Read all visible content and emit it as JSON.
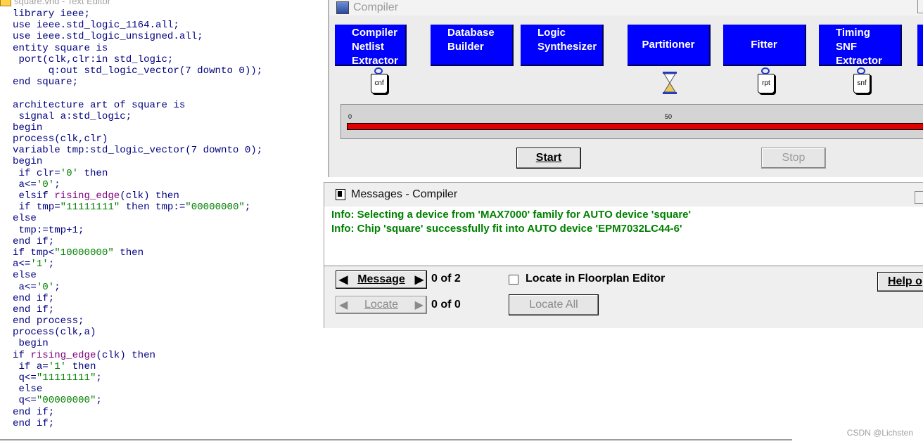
{
  "editor": {
    "title": "square.vhd - Text Editor",
    "lines": [
      [
        {
          "t": "library ieee;"
        }
      ],
      [
        {
          "t": "use ieee.std_logic_1164.all;"
        }
      ],
      [
        {
          "t": "use ieee.std_logic_unsigned.all;"
        }
      ],
      [
        {
          "t": "entity square is"
        }
      ],
      [
        {
          "t": " port(clk,clr:in std_logic;"
        }
      ],
      [
        {
          "t": "      q:out std_logic_vector(7 downto 0));"
        }
      ],
      [
        {
          "t": "end square;"
        }
      ],
      [
        {
          "t": ""
        }
      ],
      [
        {
          "t": "architecture art of square is"
        }
      ],
      [
        {
          "t": " signal a:std_logic;"
        }
      ],
      [
        {
          "t": "begin"
        }
      ],
      [
        {
          "t": "process(clk,clr)"
        }
      ],
      [
        {
          "t": "variable tmp:std_logic_vector(7 downto 0);"
        }
      ],
      [
        {
          "t": "begin"
        }
      ],
      [
        {
          "t": " if clr="
        },
        {
          "t": "'0'",
          "c": "st"
        },
        {
          "t": " then"
        }
      ],
      [
        {
          "t": " a<="
        },
        {
          "t": "'0'",
          "c": "st"
        },
        {
          "t": ";"
        }
      ],
      [
        {
          "t": " elsif "
        },
        {
          "t": "rising_edge",
          "c": "fn"
        },
        {
          "t": "(clk) then"
        }
      ],
      [
        {
          "t": " if tmp="
        },
        {
          "t": "\"11111111\"",
          "c": "st"
        },
        {
          "t": " then tmp:="
        },
        {
          "t": "\"00000000\"",
          "c": "st"
        },
        {
          "t": ";"
        }
      ],
      [
        {
          "t": "else"
        }
      ],
      [
        {
          "t": " tmp:=tmp+1;"
        }
      ],
      [
        {
          "t": "end if;"
        }
      ],
      [
        {
          "t": "if tmp<"
        },
        {
          "t": "\"10000000\"",
          "c": "st"
        },
        {
          "t": " then"
        }
      ],
      [
        {
          "t": "a<="
        },
        {
          "t": "'1'",
          "c": "st"
        },
        {
          "t": ";"
        }
      ],
      [
        {
          "t": "else"
        }
      ],
      [
        {
          "t": " a<="
        },
        {
          "t": "'0'",
          "c": "st"
        },
        {
          "t": ";"
        }
      ],
      [
        {
          "t": "end if;"
        }
      ],
      [
        {
          "t": "end if;"
        }
      ],
      [
        {
          "t": "end process;"
        }
      ],
      [
        {
          "t": "process(clk,a)"
        }
      ],
      [
        {
          "t": " begin"
        }
      ],
      [
        {
          "t": "if "
        },
        {
          "t": "rising_edge",
          "c": "fn"
        },
        {
          "t": "(clk) then"
        }
      ],
      [
        {
          "t": " if a="
        },
        {
          "t": "'1'",
          "c": "st"
        },
        {
          "t": " then"
        }
      ],
      [
        {
          "t": " q<="
        },
        {
          "t": "\"11111111\"",
          "c": "st"
        },
        {
          "t": ";"
        }
      ],
      [
        {
          "t": " else"
        }
      ],
      [
        {
          "t": " q<="
        },
        {
          "t": "\"00000000\"",
          "c": "st"
        },
        {
          "t": ";"
        }
      ],
      [
        {
          "t": "end if;"
        }
      ],
      [
        {
          "t": "end if;"
        }
      ]
    ]
  },
  "compiler": {
    "title": "Compiler",
    "modules": [
      {
        "label": "Compiler\nNetlist\nExtractor",
        "file": "cnf"
      },
      {
        "label": "Database\nBuilder"
      },
      {
        "label": "Logic\nSynthesizer"
      },
      {
        "label": "Partitioner"
      },
      {
        "label": "Fitter",
        "file": "rpt"
      },
      {
        "label": "Timing\nSNF\nExtractor",
        "file": "snf"
      }
    ],
    "progress": {
      "tick_start": "0",
      "tick_mid": "50",
      "percent": 100
    },
    "start_label": "Start",
    "stop_label": "Stop"
  },
  "messages": {
    "title": "Messages - Compiler",
    "lines": [
      "Info: Selecting a device from 'MAX7000' family for AUTO device 'square'",
      "Info: Chip 'square' successfully fit into AUTO device 'EPM7032LC44-6'"
    ],
    "message_button": "Message",
    "message_count": "0 of 2",
    "locate_button": "Locate",
    "locate_count": "0 of 0",
    "locate_floorplan_label": "Locate in Floorplan Editor",
    "locate_all_label": "Locate All",
    "help_label": "Help o"
  },
  "watermark": "CSDN @Lichsten",
  "colors": {
    "module_blue": "#0000fe",
    "message_green": "#008000",
    "progress_red": "#e00000",
    "code_keyword": "#000080"
  }
}
